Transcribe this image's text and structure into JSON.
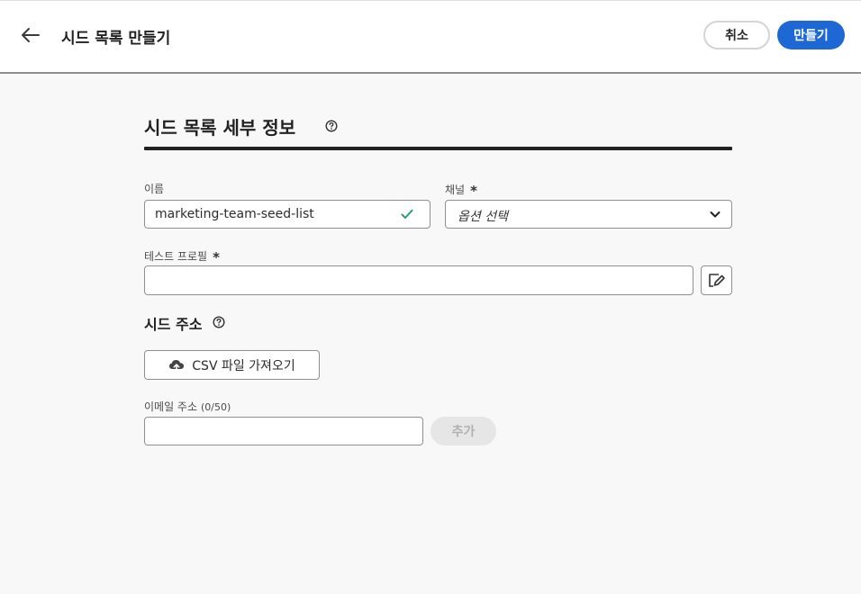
{
  "header": {
    "title": "시드 목록 만들기",
    "cancel_label": "취소",
    "create_label": "만들기"
  },
  "details": {
    "title": "시드 목록 세부 정보",
    "name_label": "이름",
    "name_value": "marketing-team-seed-list",
    "channel_label": "채널",
    "channel_required": "*",
    "channel_placeholder": "옵션 선택",
    "profile_label": "테스트 프로필",
    "profile_required": "*",
    "profile_value": ""
  },
  "seed": {
    "title": "시드 주소",
    "import_label": "CSV 파일 가져오기",
    "email_label": "이메일 주소",
    "email_count": "(0/50)",
    "email_value": "",
    "add_label": "추가"
  },
  "colors": {
    "accent": "#1e68d6",
    "valid": "#2d9d78",
    "disabled_bg": "#e6e6e6",
    "disabled_text": "#b1b1b1"
  },
  "icons": {
    "back": "arrow-left-icon",
    "help": "help-circle-icon",
    "valid": "checkmark-icon",
    "dropdown": "chevron-down-icon",
    "edit": "edit-icon",
    "upload": "cloud-upload-icon"
  }
}
